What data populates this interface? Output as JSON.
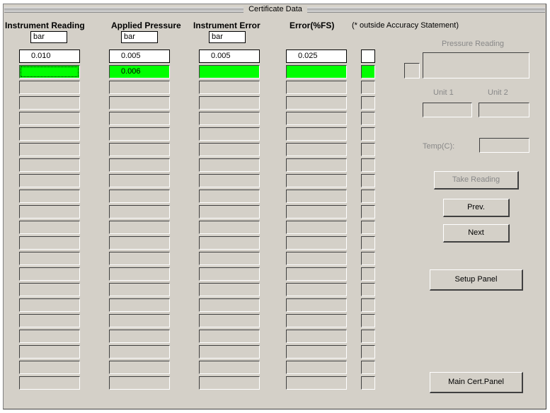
{
  "title": "Certificate Data",
  "columns": {
    "instrument_reading": "Instrument Reading",
    "applied_pressure": "Applied Pressure",
    "instrument_error": "Instrument Error",
    "error_fs": "Error(%FS)"
  },
  "accuracy_note": "(* outside Accuracy Statement)",
  "units": {
    "instrument_reading": "bar",
    "applied_pressure": "bar",
    "instrument_error": "bar"
  },
  "rows": [
    {
      "instrument_reading": "0.010",
      "applied_pressure": "0.005",
      "instrument_error": "0.005",
      "error_fs": "0.025",
      "flag": ""
    },
    {
      "instrument_reading": "",
      "applied_pressure": "0.006",
      "instrument_error": "",
      "error_fs": "",
      "flag": ""
    }
  ],
  "empty_rows": 20,
  "right_panel": {
    "pressure_reading_label": "Pressure Reading",
    "unit1_label": "Unit 1",
    "unit2_label": "Unit 2",
    "temp_label": "Temp(C):",
    "take_reading": "Take Reading",
    "prev": "Prev.",
    "next": "Next",
    "setup_panel": "Setup Panel",
    "main_cert_panel": "Main Cert.Panel"
  },
  "colors": {
    "active_row": "#00ff00",
    "window_bg": "#d4d0c8"
  }
}
